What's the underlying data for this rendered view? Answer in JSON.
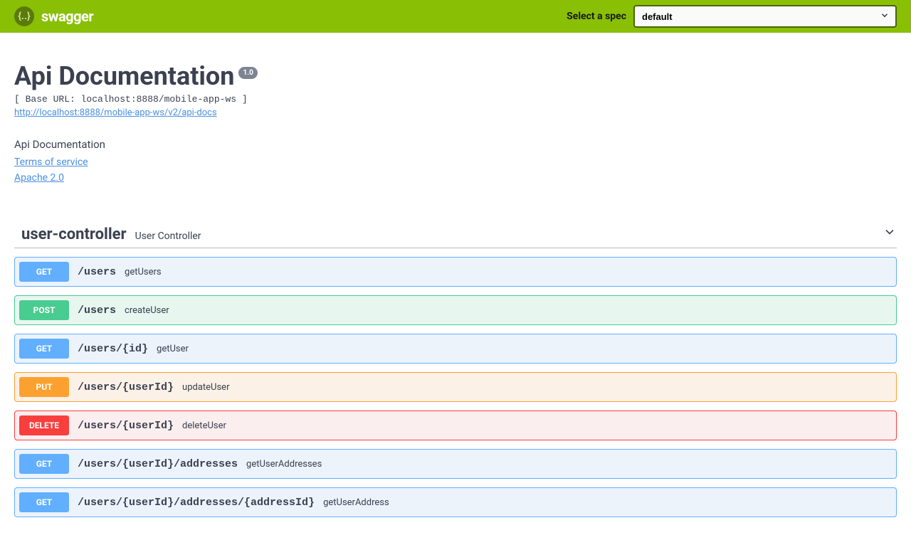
{
  "topbar": {
    "brand": "swagger",
    "spec_label": "Select a spec",
    "spec_selected": "default"
  },
  "info": {
    "title": "Api Documentation",
    "version": "1.0",
    "base_url_label": "[ Base URL: localhost:8888/mobile-app-ws ]",
    "docs_url": "http://localhost:8888/mobile-app-ws/v2/api-docs",
    "description": "Api Documentation",
    "terms_label": "Terms of service",
    "license_label": "Apache 2.0"
  },
  "tag": {
    "name": "user-controller",
    "description": "User Controller"
  },
  "operations": [
    {
      "method": "GET",
      "path": "/users",
      "summary": "getUsers"
    },
    {
      "method": "POST",
      "path": "/users",
      "summary": "createUser"
    },
    {
      "method": "GET",
      "path": "/users/{id}",
      "summary": "getUser"
    },
    {
      "method": "PUT",
      "path": "/users/{userId}",
      "summary": "updateUser"
    },
    {
      "method": "DELETE",
      "path": "/users/{userId}",
      "summary": "deleteUser"
    },
    {
      "method": "GET",
      "path": "/users/{userId}/addresses",
      "summary": "getUserAddresses"
    },
    {
      "method": "GET",
      "path": "/users/{userId}/addresses/{addressId}",
      "summary": "getUserAddress"
    }
  ]
}
